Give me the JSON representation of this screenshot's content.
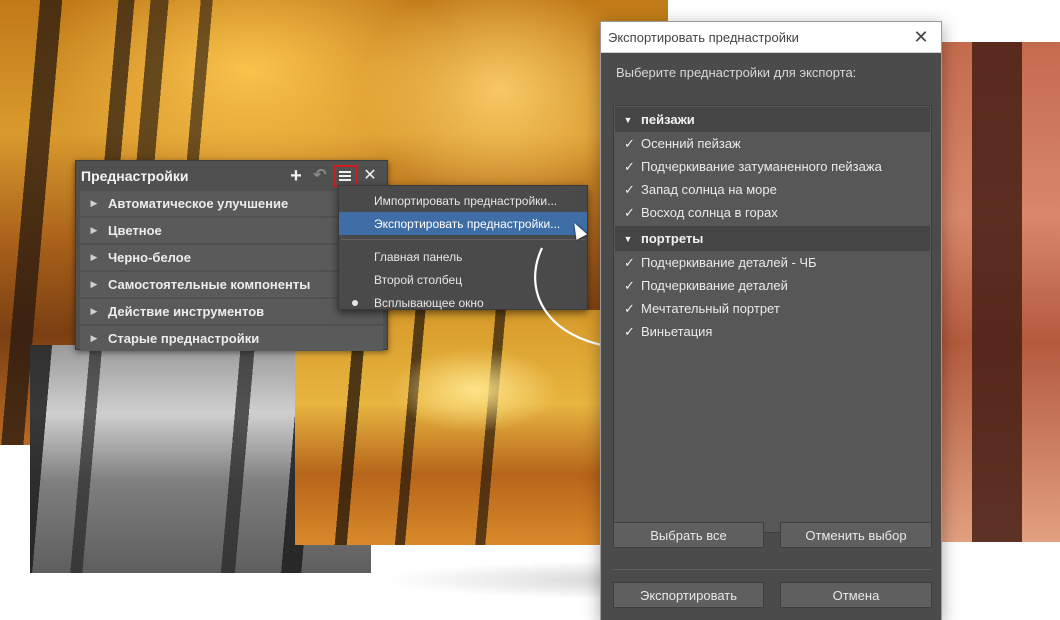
{
  "presets_panel": {
    "title": "Преднастройки",
    "add_icon": "plus-icon",
    "undo_icon": "undo-icon",
    "menu_icon": "hamburger-icon",
    "close_icon": "close-icon",
    "groups": [
      {
        "label": "Автоматическое улучшение"
      },
      {
        "label": "Цветное"
      },
      {
        "label": "Черно-белое"
      },
      {
        "label": "Самостоятельные компоненты"
      },
      {
        "label": "Действие инструментов"
      },
      {
        "label": "Старые преднастройки"
      }
    ]
  },
  "menu": {
    "items": [
      {
        "label": "Импортировать преднастройки...",
        "highlighted": false
      },
      {
        "label": "Экспортировать преднастройки...",
        "highlighted": true
      }
    ],
    "layout_items": [
      {
        "label": "Главная панель",
        "selected": false
      },
      {
        "label": "Второй столбец",
        "selected": false
      },
      {
        "label": "Всплывающее окно",
        "selected": true
      }
    ],
    "highlight_color": "#3f6ea6",
    "menu_button_outline_color": "#d01e1e"
  },
  "export_dialog": {
    "title": "Экспортировать преднастройки",
    "prompt": "Выберите преднастройки для экспорта:",
    "categories": [
      {
        "label": "пейзажи",
        "items": [
          {
            "label": "Осенний пейзаж",
            "checked": true
          },
          {
            "label": "Подчеркивание затуманенного пейзажа",
            "checked": true
          },
          {
            "label": "Запад солнца на море",
            "checked": true
          },
          {
            "label": "Восход солнца в горах",
            "checked": true
          }
        ]
      },
      {
        "label": "портреты",
        "items": [
          {
            "label": "Подчеркивание деталей - ЧБ",
            "checked": true
          },
          {
            "label": "Подчеркивание деталей",
            "checked": true
          },
          {
            "label": "Мечтательный портрет",
            "checked": true
          },
          {
            "label": "Виньетация",
            "checked": true
          }
        ]
      }
    ],
    "select_all_label": "Выбрать все",
    "deselect_label": "Отменить выбор",
    "export_label": "Экспортировать",
    "cancel_label": "Отмена",
    "check_glyph": "✓",
    "collapse_glyph": "▼"
  }
}
